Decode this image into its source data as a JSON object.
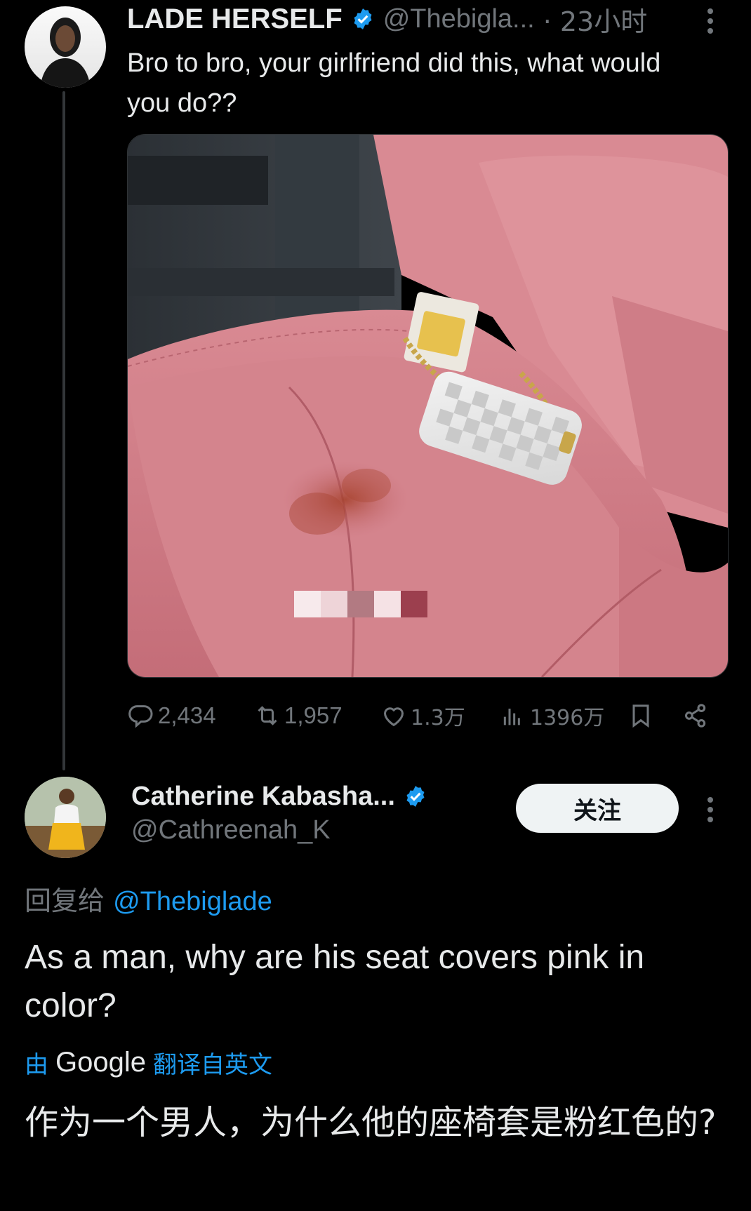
{
  "tweet": {
    "name": "LADE HERSELF",
    "handle": "@Thebigla...",
    "time": "· 23小时",
    "text": "Bro to bro, your girlfriend did this, what would you do??",
    "stats": {
      "replies": "2,434",
      "retweets": "1,957",
      "likes": "1.3万",
      "views": "1396万"
    }
  },
  "reply": {
    "name": "Catherine Kabasha...",
    "handle": "@Cathreenah_K",
    "follow_label": "关注",
    "reply_to_prefix": "回复给",
    "reply_to_handle": "@Thebiglade",
    "text": "As a man, why are his seat covers pink in color?",
    "translate_prefix": "由",
    "translate_brand": "Google",
    "translate_suffix": "翻译自英文",
    "translated_text": "作为一个男人，为什么他的座椅套是粉红色的?"
  },
  "colors": {
    "background": "#000000",
    "accent": "#1d9bf0",
    "muted": "#71767b",
    "text": "#e7e9ea"
  }
}
